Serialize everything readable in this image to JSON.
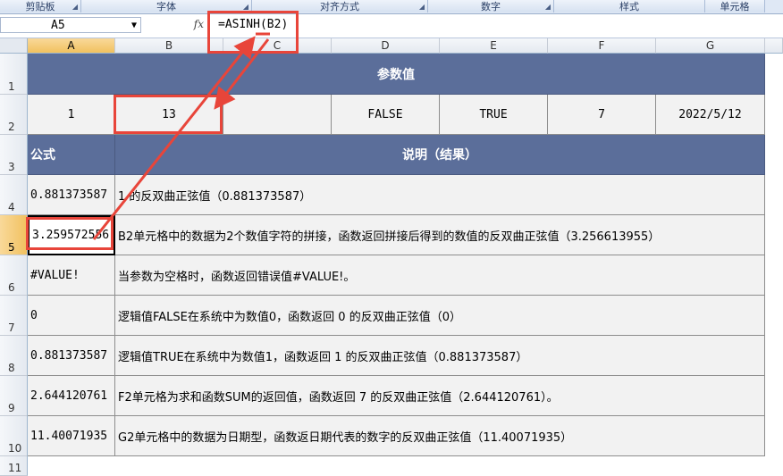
{
  "ribbon": {
    "groups": [
      "剪贴板",
      "字体",
      "对齐方式",
      "数字",
      "样式",
      "单元格"
    ]
  },
  "formula_bar": {
    "name_box": "A5",
    "fx_label": "fx",
    "formula": "=ASINH(B2)"
  },
  "columns": [
    "A",
    "B",
    "C",
    "D",
    "E",
    "F",
    "G"
  ],
  "rows": [
    "1",
    "2",
    "3",
    "4",
    "5",
    "6",
    "7",
    "8",
    "9",
    "10",
    "11"
  ],
  "sheet": {
    "title": "参数值",
    "params": [
      "1",
      "13",
      "",
      "FALSE",
      "TRUE",
      "7",
      "2022/5/12"
    ],
    "header_formula": "公式",
    "header_desc": "说明（结果）",
    "results": [
      {
        "value": "0.881373587",
        "desc": "1 的反双曲正弦值（0.881373587）"
      },
      {
        "value": "3.259572556",
        "desc": "B2单元格中的数据为2个数值字符的拼接，函数返回拼接后得到的数值的反双曲正弦值（3.256613955）"
      },
      {
        "value": "#VALUE!",
        "desc": "当参数为空格时，函数返回错误值#VALUE!。"
      },
      {
        "value": "0",
        "desc": "逻辑值FALSE在系统中为数值0，函数返回 0 的反双曲正弦值（0）"
      },
      {
        "value": "0.881373587",
        "desc": "逻辑值TRUE在系统中为数值1，函数返回 1 的反双曲正弦值（0.881373587）"
      },
      {
        "value": "2.644120761",
        "desc": "F2单元格为求和函数SUM的返回值，函数返回 7 的反双曲正弦值（2.644120761）。"
      },
      {
        "value": "11.40071935",
        "desc": "G2单元格中的数据为日期型，函数返日期代表的数字的反双曲正弦值（11.40071935）"
      }
    ]
  },
  "colors": {
    "header_fill": "#5b6e9a",
    "annotation_red": "#e8453a",
    "selected_header": "#f1c15f"
  }
}
